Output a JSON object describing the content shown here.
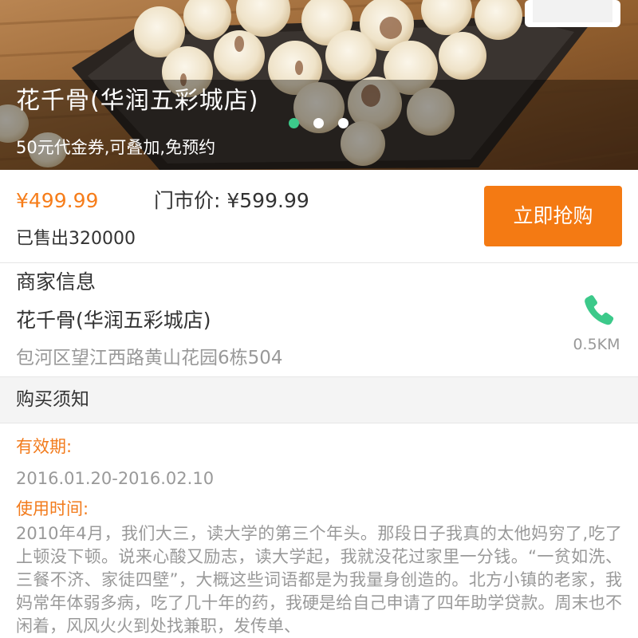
{
  "banner": {
    "title": "花千骨(华润五彩城店)",
    "subtitle": "50元代金券,可叠加,免预约",
    "active_dot_color": "#3cc98a",
    "dot_count": 3,
    "active_dot_index": 0
  },
  "deal": {
    "price": "¥499.99",
    "market_price": "门市价: ¥599.99",
    "sold": "已售出320000",
    "buy_label": "立即抢购",
    "accent_color": "#f47a13"
  },
  "merchant": {
    "heading": "商家信息",
    "name": "花千骨(华润五彩城店)",
    "address": "包河区望江西路黄山花园6栋504",
    "distance": "0.5KM",
    "phone_icon": "phone-icon",
    "phone_icon_color": "#3cc98a"
  },
  "notice": {
    "title": "购买须知",
    "validity_label": "有效期:",
    "validity_value": "2016.01.20-2016.02.10",
    "time_label": "使用时间:",
    "time_description": "2010年4月，我们大三，读大学的第三个年头。那段日子我真的太他妈穷了,吃了上顿没下顿。说来心酸又励志，读大学起，我就没花过家里一分钱。“一贫如洗、三餐不济、家徒四壁”，大概这些词语都是为我量身创造的。北方小镇的老家，我妈常年体弱多病，吃了几十年的药，我硬是给自己申请了四年助学贷款。周末也不闲着，风风火火到处找兼职，发传单、"
  }
}
